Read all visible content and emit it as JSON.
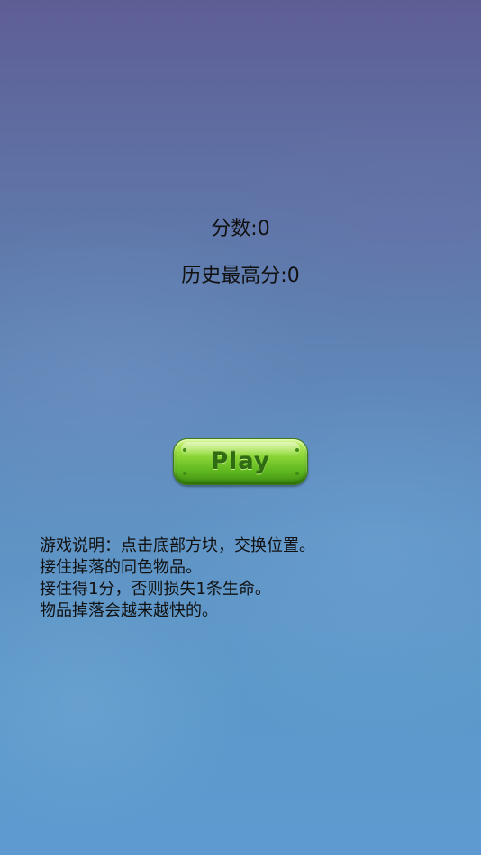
{
  "score": {
    "text": "分数:0",
    "value": 0
  },
  "best_score": {
    "text": "历史最高分:0",
    "value": 0
  },
  "play_button": {
    "label": "Play"
  },
  "instructions": {
    "lines": [
      "游戏说明：点击底部方块，交换位置。",
      "接住掉落的同色物品。",
      "接住得1分，否则损失1条生命。",
      "物品掉落会越来越快的。"
    ]
  },
  "colors": {
    "background_top": "#5e5e95",
    "background_bottom": "#5e9ad0",
    "button_green": "#8ed83a",
    "button_text": "#2f6b12",
    "text": "#111111"
  }
}
